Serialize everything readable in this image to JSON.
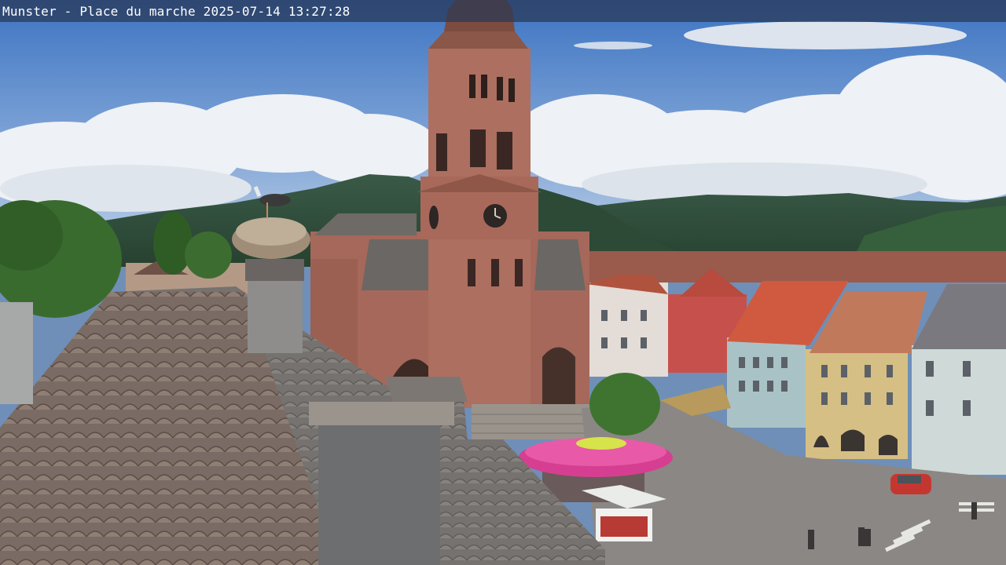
{
  "overlay": {
    "caption": "Munster - Place du marche 2025-07-14 13:27:28"
  },
  "palette": {
    "sky_top": "#3f78c6",
    "sky_bottom": "#a9c3e2",
    "cloud": "#f2f4f7",
    "mountain": "#2f4f3c",
    "church": "#a86a5c",
    "roof": "#6e6a66",
    "parasol": "#e0449a",
    "tree": "#3c6b2f"
  }
}
